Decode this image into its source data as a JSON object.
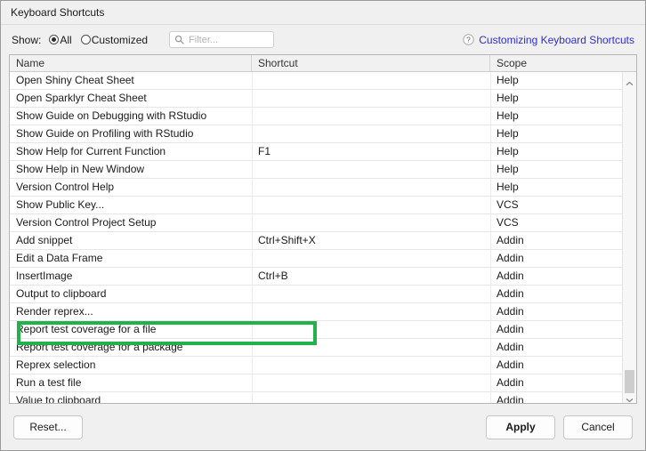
{
  "window": {
    "title": "Keyboard Shortcuts"
  },
  "filter_bar": {
    "show_label": "Show:",
    "radios": [
      {
        "label": "All",
        "checked": true
      },
      {
        "label": "Customized",
        "checked": false
      }
    ],
    "search": {
      "value": "",
      "placeholder": "Filter...",
      "icon": "search-icon"
    },
    "help_link": {
      "label": "Customizing Keyboard Shortcuts",
      "icon": "question-mark-icon",
      "color": "#2f2fd0"
    }
  },
  "table": {
    "columns": [
      "Name",
      "Shortcut",
      "Scope"
    ],
    "rows": [
      {
        "name": "Open Shiny Cheat Sheet",
        "shortcut": "",
        "scope": "Help"
      },
      {
        "name": "Open Sparklyr Cheat Sheet",
        "shortcut": "",
        "scope": "Help"
      },
      {
        "name": "Show Guide on Debugging with RStudio",
        "shortcut": "",
        "scope": "Help"
      },
      {
        "name": "Show Guide on Profiling with RStudio",
        "shortcut": "",
        "scope": "Help"
      },
      {
        "name": "Show Help for Current Function",
        "shortcut": "F1",
        "scope": "Help"
      },
      {
        "name": "Show Help in New Window",
        "shortcut": "",
        "scope": "Help"
      },
      {
        "name": "Version Control Help",
        "shortcut": "",
        "scope": "Help"
      },
      {
        "name": "Show Public Key...",
        "shortcut": "",
        "scope": "VCS"
      },
      {
        "name": "Version Control Project Setup",
        "shortcut": "",
        "scope": "VCS"
      },
      {
        "name": "Add snippet",
        "shortcut": "Ctrl+Shift+X",
        "scope": "Addin"
      },
      {
        "name": "Edit a Data Frame",
        "shortcut": "",
        "scope": "Addin"
      },
      {
        "name": "InsertImage",
        "shortcut": "Ctrl+B",
        "scope": "Addin"
      },
      {
        "name": "Output to clipboard",
        "shortcut": "",
        "scope": "Addin"
      },
      {
        "name": "Render reprex...",
        "shortcut": "",
        "scope": "Addin"
      },
      {
        "name": "Report test coverage for a file",
        "shortcut": "",
        "scope": "Addin"
      },
      {
        "name": "Report test coverage for a package",
        "shortcut": "",
        "scope": "Addin"
      },
      {
        "name": "Reprex selection",
        "shortcut": "",
        "scope": "Addin"
      },
      {
        "name": "Run a test file",
        "shortcut": "",
        "scope": "Addin"
      },
      {
        "name": "Value to clipboard",
        "shortcut": "",
        "scope": "Addin"
      }
    ]
  },
  "annotation": {
    "color": "#22b14c",
    "target_row_name": "InsertImage",
    "target_row_shortcut": "Ctrl+B"
  },
  "scrollbar": {
    "up_icon": "chevron-up-icon",
    "down_icon": "chevron-down-icon"
  },
  "footer": {
    "reset_label": "Reset...",
    "apply_label": "Apply",
    "cancel_label": "Cancel"
  }
}
